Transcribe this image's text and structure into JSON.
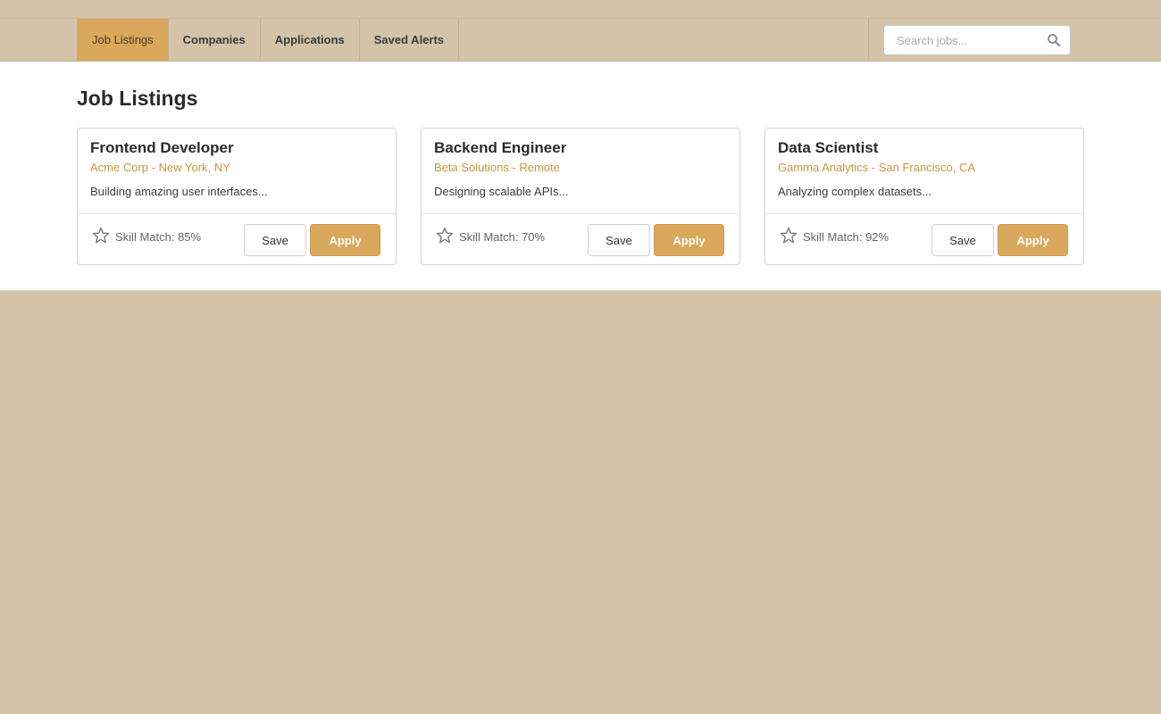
{
  "nav": {
    "items": [
      {
        "label": "Job Listings",
        "active": true
      },
      {
        "label": "Companies",
        "active": false
      },
      {
        "label": "Applications",
        "active": false
      },
      {
        "label": "Saved Alerts",
        "active": false
      }
    ],
    "search": {
      "placeholder": "Search jobs...",
      "value": "",
      "icon": "search-icon"
    }
  },
  "main": {
    "title": "Job Listings",
    "jobs": [
      {
        "title": "Frontend Developer",
        "meta": "Acme Corp - New York, NY",
        "description": "Building amazing user interfaces...",
        "match": "Skill Match: 85%",
        "save_label": "Save",
        "apply_label": "Apply"
      },
      {
        "title": "Backend Engineer",
        "meta": "Beta Solutions - Remote",
        "description": "Designing scalable APIs...",
        "match": "Skill Match: 70%",
        "save_label": "Save",
        "apply_label": "Apply"
      },
      {
        "title": "Data Scientist",
        "meta": "Gamma Analytics - San Francisco, CA",
        "description": "Analyzing complex datasets...",
        "match": "Skill Match: 92%",
        "save_label": "Save",
        "apply_label": "Apply"
      }
    ]
  },
  "colors": {
    "background": "#d4c3a9",
    "accent": "#d9a85c",
    "meta_text": "#c8953e",
    "surface": "#ffffff"
  }
}
